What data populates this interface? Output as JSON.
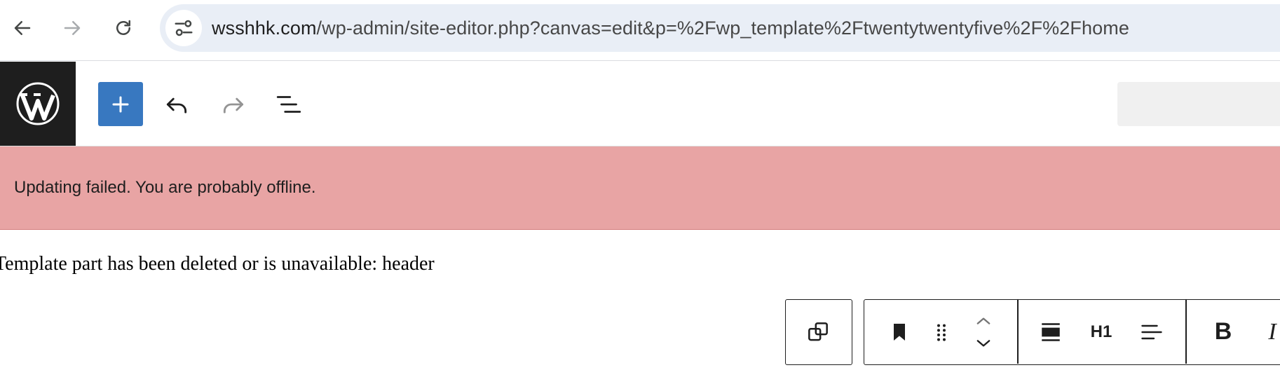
{
  "browser": {
    "url_domain": "wsshhk.com",
    "url_path": "/wp-admin/site-editor.php?canvas=edit&p=%2Fwp_template%2Ftwentytwentyfive%2F%2Fhome",
    "icons": [
      "back-icon",
      "forward-icon",
      "reload-icon",
      "site-info-icon"
    ]
  },
  "editor_header": {
    "logo": "wordpress-logo",
    "tools": [
      "add-block",
      "undo",
      "redo",
      "document-overview"
    ],
    "accent_color": "#3878c0"
  },
  "notice": {
    "message": "Updating failed. You are probably offline.",
    "background": "#e8a4a4"
  },
  "canvas": {
    "missing_template_message": "Template part has been deleted or is unavailable: header"
  },
  "block_toolbar": {
    "heading_level_label": "H1",
    "bold_label": "B",
    "italic_label": "I",
    "icons": [
      "duplicate-icon",
      "bookmark-icon",
      "drag-handle-icon",
      "move-up-icon",
      "move-down-icon",
      "align-icon",
      "text-align-icon"
    ]
  }
}
